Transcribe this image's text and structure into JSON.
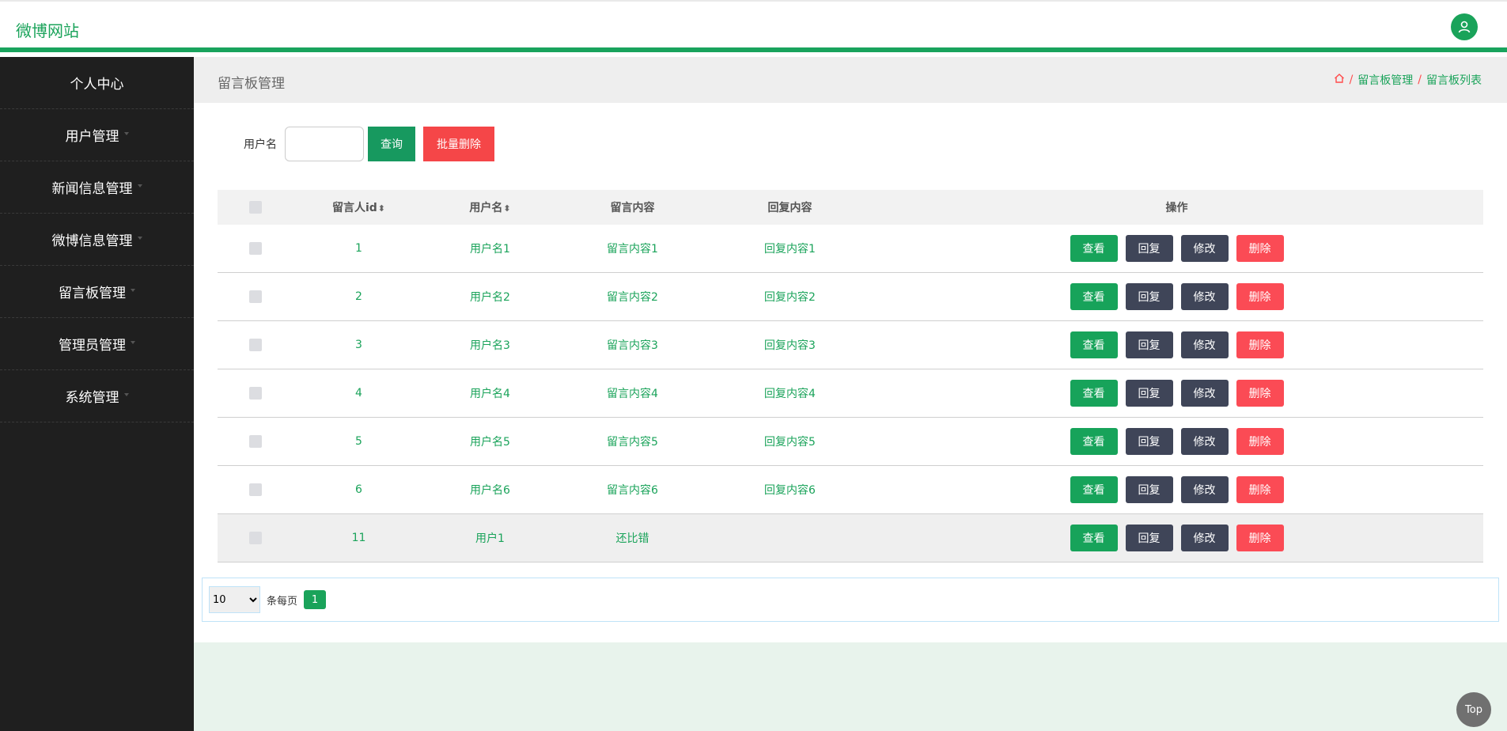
{
  "site": {
    "title": "微博网站",
    "user_icon": "user-icon"
  },
  "sidebar": {
    "items": [
      {
        "label": "个人中心"
      },
      {
        "label": "用户管理"
      },
      {
        "label": "新闻信息管理"
      },
      {
        "label": "微博信息管理"
      },
      {
        "label": "留言板管理"
      },
      {
        "label": "管理员管理"
      },
      {
        "label": "系统管理"
      }
    ]
  },
  "header": {
    "title": "留言板管理",
    "breadcrumb": [
      "留言板管理",
      "留言板列表"
    ],
    "home_icon": "home-icon"
  },
  "search": {
    "label": "用户名",
    "value": "",
    "query_label": "查询",
    "batch_delete_label": "批量删除"
  },
  "table": {
    "columns": [
      "留言人id",
      "用户名",
      "留言内容",
      "回复内容",
      "操作"
    ],
    "actions": [
      "查看",
      "回复",
      "修改",
      "删除"
    ],
    "rows": [
      {
        "id": "1",
        "username": "用户名1",
        "message": "留言内容1",
        "reply": "回复内容1"
      },
      {
        "id": "2",
        "username": "用户名2",
        "message": "留言内容2",
        "reply": "回复内容2"
      },
      {
        "id": "3",
        "username": "用户名3",
        "message": "留言内容3",
        "reply": "回复内容3"
      },
      {
        "id": "4",
        "username": "用户名4",
        "message": "留言内容4",
        "reply": "回复内容4"
      },
      {
        "id": "5",
        "username": "用户名5",
        "message": "留言内容5",
        "reply": "回复内容5"
      },
      {
        "id": "6",
        "username": "用户名6",
        "message": "留言内容6",
        "reply": "回复内容6"
      },
      {
        "id": "11",
        "username": "用户1",
        "message": "还比错",
        "reply": ""
      }
    ]
  },
  "pager": {
    "page_size": "10",
    "per_label": "条每页",
    "current_page": "1"
  },
  "top_button": {
    "label": "Top"
  },
  "colors": {
    "accent": "#1aa35a",
    "danger": "#fb4b55",
    "dark": "#3f4558",
    "sidebar": "#1f1f1f"
  }
}
